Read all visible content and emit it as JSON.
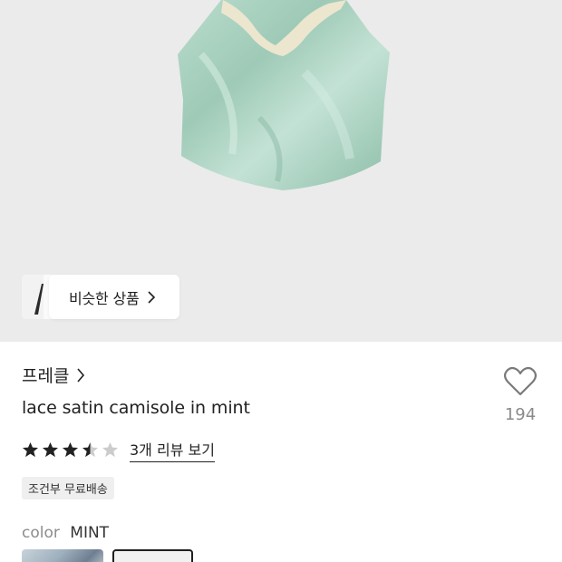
{
  "similar": {
    "label": "비슷한 상품"
  },
  "brand": {
    "name": "프레클"
  },
  "product": {
    "name": "lace satin camisole in mint"
  },
  "like": {
    "count": "194"
  },
  "rating": {
    "stars": 3.5,
    "max": 5,
    "reviews_label": "3개 리뷰 보기"
  },
  "shipping_badge": "조건부 무료배송",
  "color": {
    "label": "color",
    "value": "MINT"
  },
  "icons": {
    "heart": "heart-outline-icon",
    "chevron": "chevron-right-icon",
    "star": "star-icon"
  },
  "colors": {
    "star_filled": "#222222",
    "star_empty": "#cccccc",
    "garment": "#a9d3c1",
    "lace": "#ece6cf"
  }
}
